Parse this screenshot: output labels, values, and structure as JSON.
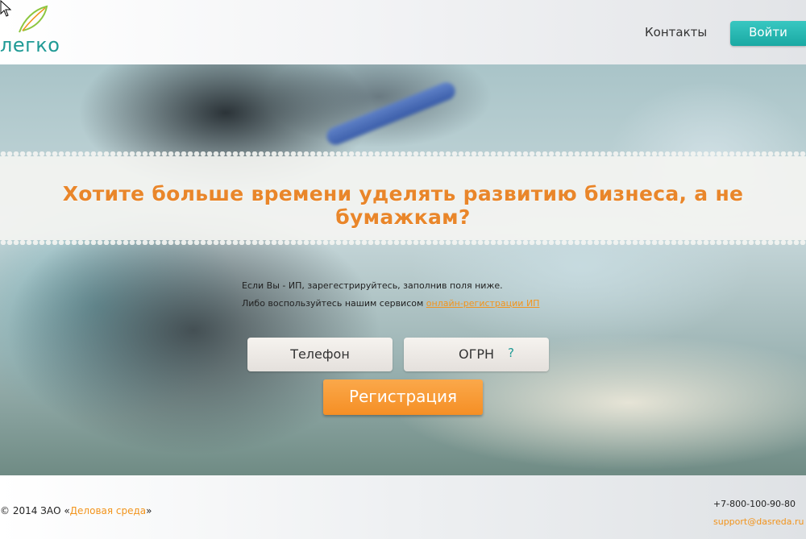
{
  "header": {
    "logo_text": "легко",
    "nav_contacts": "Контакты",
    "login_label": "Войти"
  },
  "hero": {
    "headline": "Хотите больше времени уделять развитию бизнеса, а не бумажкам?",
    "info_line1": "Если Вы - ИП, зарегестрируйтесь, заполнив поля ниже.",
    "info_line2_prefix": "Либо воспользуйтесь нашим сервисом",
    "info_link": "онлайн-регистрации ИП",
    "phone_placeholder": "Телефон",
    "ogrn_placeholder": "ОГРН",
    "help_mark": "?",
    "register_label": "Регистрация"
  },
  "footer": {
    "copyright_prefix": "© 2014 ЗАО «",
    "company_link": "Деловая среда",
    "copyright_suffix": "»",
    "phone": "+7-800-100-90-80",
    "email": "support@dasreda.ru"
  },
  "colors": {
    "accent_orange": "#f58f25",
    "brand_teal": "#1f9a95"
  },
  "icons": [
    "leaf-logo-icon",
    "mouse-cursor-icon"
  ]
}
